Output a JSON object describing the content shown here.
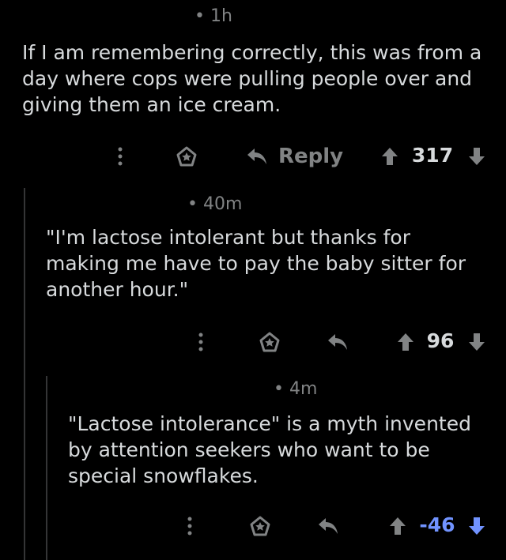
{
  "comments": [
    {
      "time": "• 1h",
      "body": "If I am remembering correctly, this was from a day where cops were pulling people over and giving them an ice cream.",
      "reply_label": "Reply",
      "score": "317"
    },
    {
      "time": "• 40m",
      "body": "\"I'm lactose intolerant but thanks for making me have to pay the baby sitter for another hour.\"",
      "reply_label": "",
      "score": "96"
    },
    {
      "time": "• 4m",
      "body": "\"Lactose intolerance\" is a myth invented by attention seekers who want to be special snowflakes.",
      "reply_label": "",
      "score": "-46",
      "downvoted": true
    }
  ],
  "colors": {
    "background": "#000000",
    "text": "#d7dadc",
    "muted": "#818384",
    "downvote_active": "#7193ff",
    "thread_line": "#343536"
  },
  "icons": [
    "more-icon",
    "award-icon",
    "reply-icon",
    "upvote-icon",
    "downvote-icon"
  ]
}
